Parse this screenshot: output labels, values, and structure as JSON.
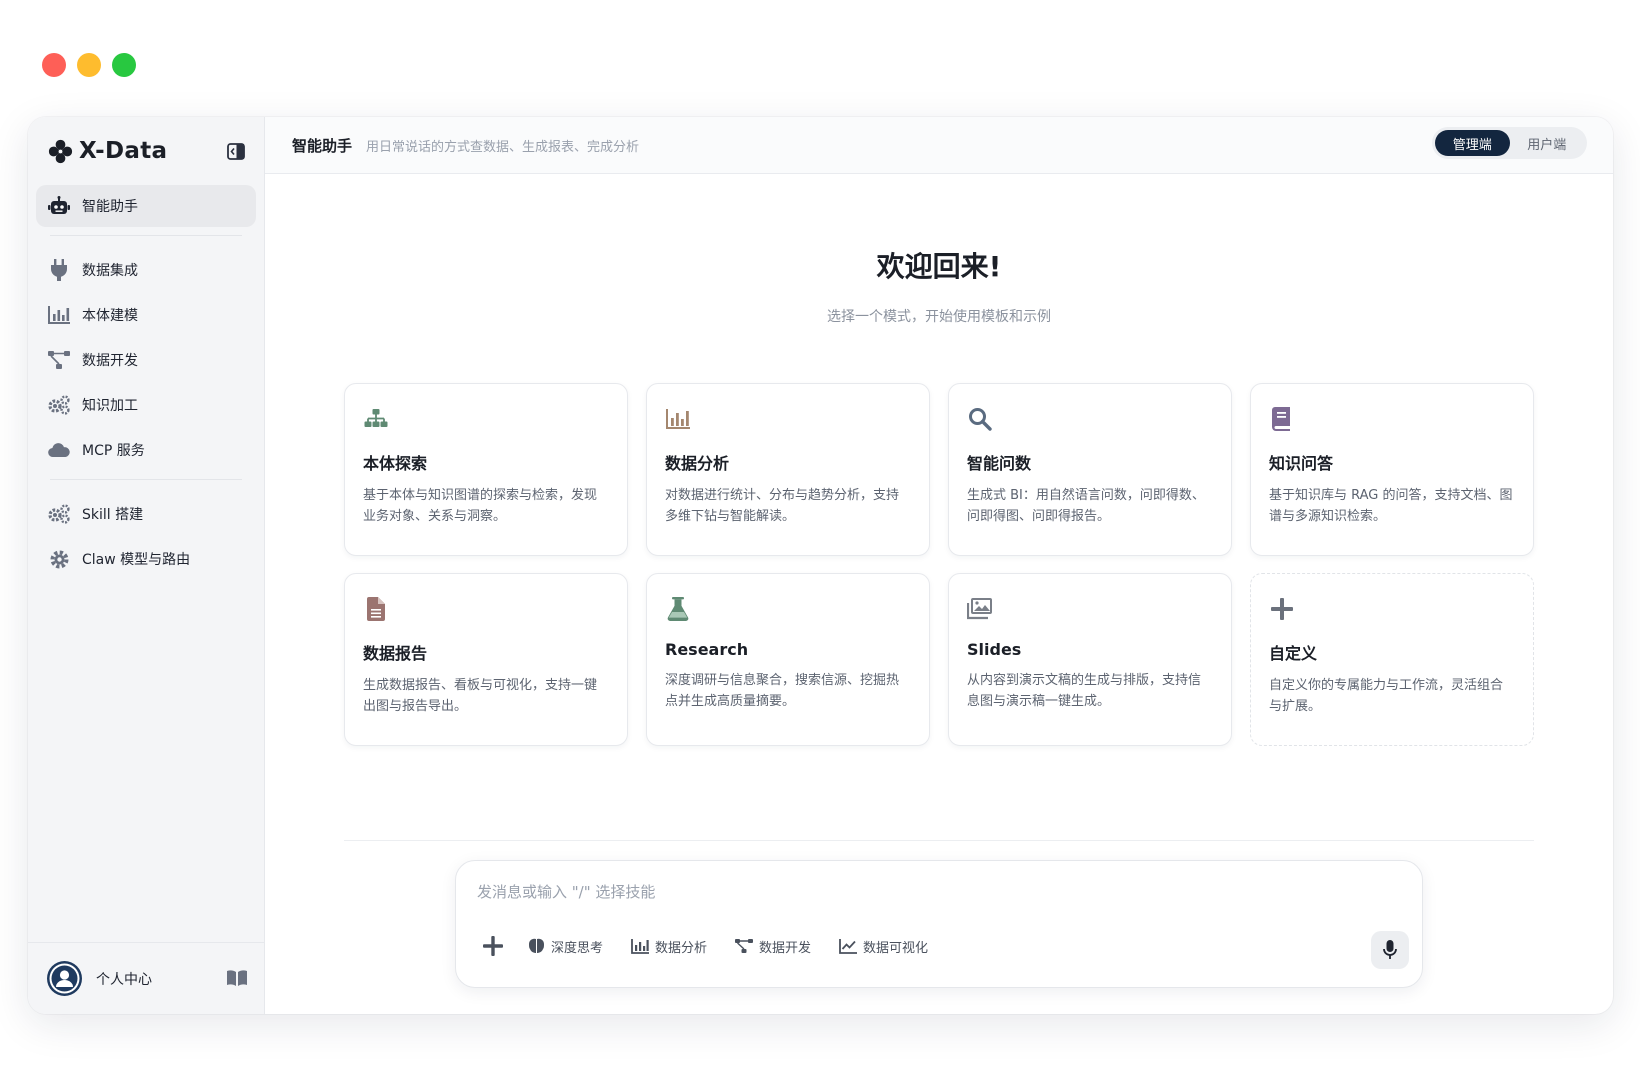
{
  "app": {
    "name": "X-Data"
  },
  "colors": {
    "accent": "#13263f",
    "traffic_red": "#fe5f57",
    "traffic_yellow": "#febc2e",
    "traffic_green": "#28c840"
  },
  "sidebar": {
    "items": [
      {
        "label": "智能助手",
        "icon": "robot-icon",
        "active": true
      },
      {
        "label": "数据集成",
        "icon": "plug-icon"
      },
      {
        "label": "本体建模",
        "icon": "bar-chart-icon"
      },
      {
        "label": "数据开发",
        "icon": "flow-icon"
      },
      {
        "label": "知识加工",
        "icon": "gears-icon"
      },
      {
        "label": "MCP 服务",
        "icon": "cloud-icon"
      },
      {
        "label": "Skill 搭建",
        "icon": "gears-icon"
      },
      {
        "label": "Claw 模型与路由",
        "icon": "gear-icon"
      }
    ],
    "footer": {
      "label": "个人中心"
    }
  },
  "header": {
    "title": "智能助手",
    "subtitle": "用日常说话的方式查数据、生成报表、完成分析",
    "roles": [
      "管理端",
      "用户端"
    ],
    "active_role": "管理端"
  },
  "welcome": {
    "title": "欢迎回来!",
    "subtitle": "选择一个模式，开始使用模板和示例"
  },
  "cards": [
    {
      "title": "本体探索",
      "desc": "基于本体与知识图谱的探索与检索，发现业务对象、关系与洞察。",
      "icon": "sitemap-icon",
      "color": "#5f8a73"
    },
    {
      "title": "数据分析",
      "desc": "对数据进行统计、分布与趋势分析，支持多维下钻与智能解读。",
      "icon": "bar-chart-icon",
      "color": "#a4876f"
    },
    {
      "title": "智能问数",
      "desc": "生成式 BI：用自然语言问数，问即得数、问即得图、问即得报告。",
      "icon": "search-icon",
      "color": "#5a6b80"
    },
    {
      "title": "知识问答",
      "desc": "基于知识库与 RAG 的问答，支持文档、图谱与多源知识检索。",
      "icon": "book-icon",
      "color": "#7d6a93"
    },
    {
      "title": "数据报告",
      "desc": "生成数据报告、看板与可视化，支持一键出图与报告导出。",
      "icon": "file-icon",
      "color": "#9b7470"
    },
    {
      "title": "Research",
      "desc": "深度调研与信息聚合，搜索信源、挖掘热点并生成高质量摘要。",
      "icon": "flask-icon",
      "color": "#5f8a73"
    },
    {
      "title": "Slides",
      "desc": "从内容到演示文稿的生成与排版，支持信息图与演示稿一键生成。",
      "icon": "images-icon",
      "color": "#7a7f88"
    },
    {
      "title": "自定义",
      "desc": "自定义你的专属能力与工作流，灵活组合与扩展。",
      "icon": "plus-icon",
      "color": "#6b717c",
      "dashed": true
    }
  ],
  "composer": {
    "placeholder": "发消息或输入 \"/\" 选择技能",
    "tools": [
      {
        "label": "深度思考",
        "icon": "brain-icon"
      },
      {
        "label": "数据分析",
        "icon": "bar-chart-icon"
      },
      {
        "label": "数据开发",
        "icon": "flow-icon"
      },
      {
        "label": "数据可视化",
        "icon": "line-chart-icon"
      }
    ]
  }
}
